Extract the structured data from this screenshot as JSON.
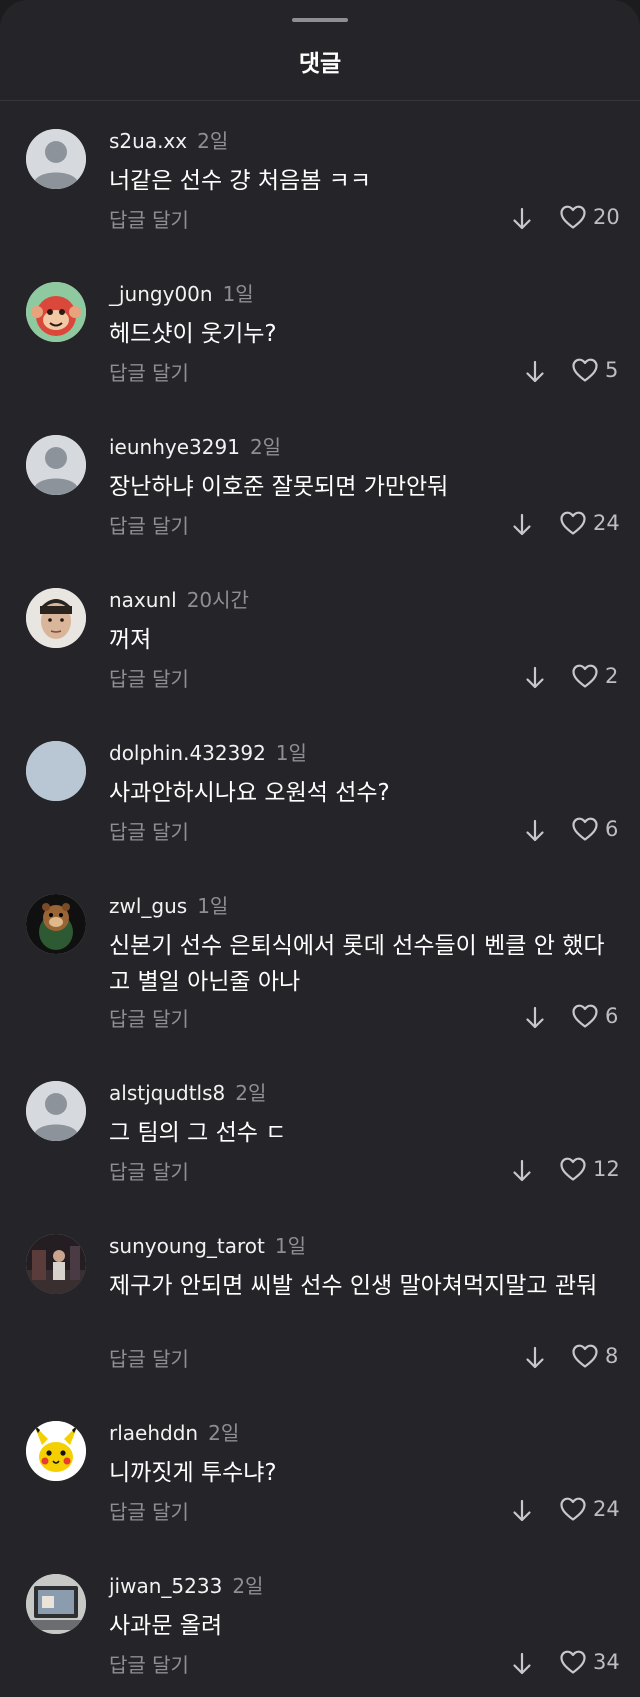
{
  "sheet": {
    "title": "댓글"
  },
  "comments": [
    {
      "username": "s2ua.xx",
      "time": "2일",
      "text": "너같은 선수 걍 처음봄 ㅋㅋ",
      "reply": "답글 달기",
      "likes": "20",
      "avatar": "default-avatar"
    },
    {
      "username": "_jungy00n",
      "time": "1일",
      "text": "헤드샷이 웃기누?",
      "reply": "답글 달기",
      "likes": "5",
      "avatar": "monkey-avatar"
    },
    {
      "username": "ieunhye3291",
      "time": "2일",
      "text": "장난하냐 이호준 잘못되면  가만안둬",
      "reply": "답글 달기",
      "likes": "24",
      "avatar": "default-avatar"
    },
    {
      "username": "naxunl",
      "time": "20시간",
      "text": "꺼져",
      "reply": "답글 달기",
      "likes": "2",
      "avatar": "face-avatar"
    },
    {
      "username": "dolphin.432392",
      "time": "1일",
      "text": "사과안하시나요 오원석 선수?",
      "reply": "답글 달기",
      "likes": "6",
      "avatar": "blank-avatar"
    },
    {
      "username": "zwl_gus",
      "time": "1일",
      "text": "신본기 선수 은퇴식에서 롯데 선수들이 벤클 안 했다고 별일 아닌줄 아나",
      "reply": "답글 달기",
      "likes": "6",
      "avatar": "chipmunk-avatar"
    },
    {
      "username": "alstjqudtls8",
      "time": "2일",
      "text": "그 팀의 그 선수 ㄷ",
      "reply": "답글 달기",
      "likes": "12",
      "avatar": "default-avatar"
    },
    {
      "username": "sunyoung_tarot",
      "time": "1일",
      "text": "제구가 안되면 씨발 선수 인생 말아쳐먹지말고 관둬",
      "reply": "답글 달기",
      "likes": "8",
      "avatar": "photo-avatar"
    },
    {
      "username": "rlaehddn",
      "time": "2일",
      "text": "니까짓게 투수냐?",
      "reply": "답글 달기",
      "likes": "24",
      "avatar": "pikachu-avatar"
    },
    {
      "username": "jiwan_5233",
      "time": "2일",
      "text": "사과문 올려",
      "reply": "답글 달기",
      "likes": "34",
      "avatar": "screen-avatar"
    }
  ],
  "colors": {
    "background": "#252529",
    "username": "#f2f2f2",
    "muted": "#8e8e93",
    "text": "#ffffff"
  },
  "icons": {
    "like": "heart-outline-icon",
    "dislike": "arrow-down-icon"
  }
}
